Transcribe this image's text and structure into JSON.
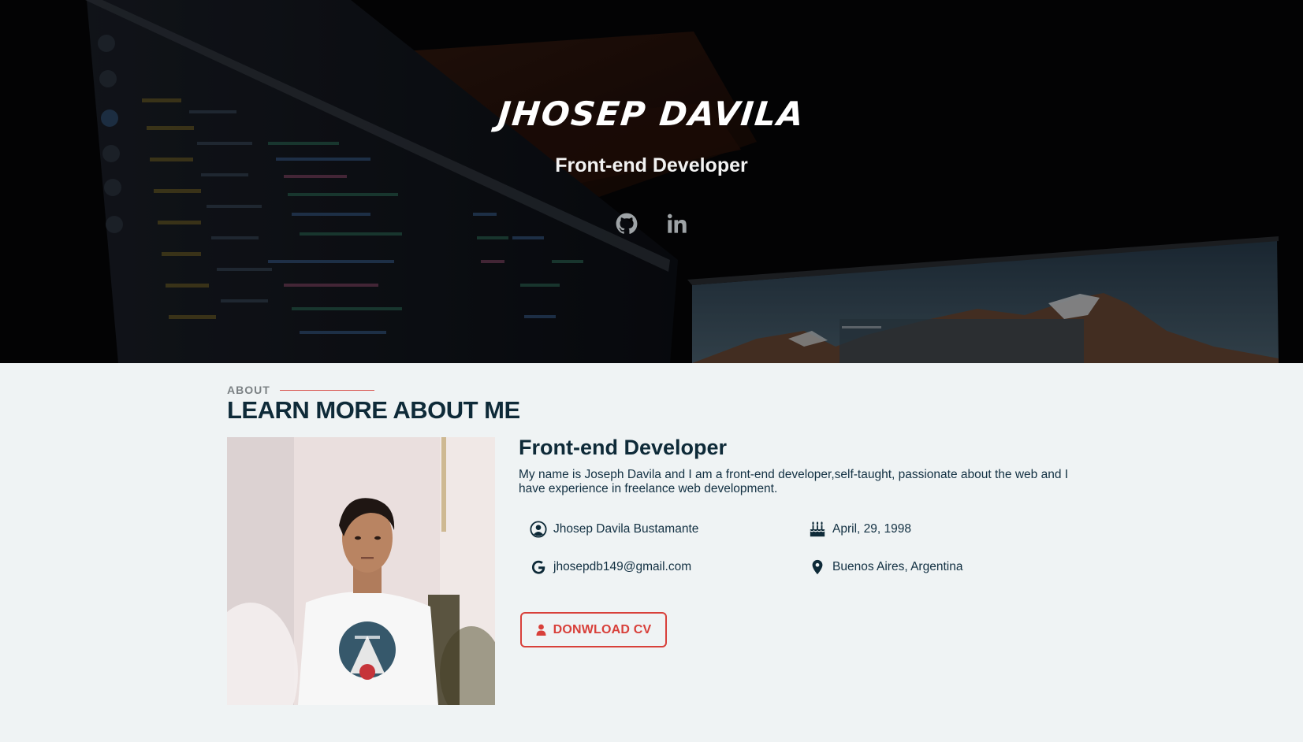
{
  "hero": {
    "name": "JHOSEP DAVILA",
    "role": "Front-end Developer",
    "social": [
      {
        "icon": "github-icon"
      },
      {
        "icon": "linkedin-icon"
      }
    ]
  },
  "about": {
    "eyebrow": "ABOUT",
    "title": "LEARN MORE ABOUT ME",
    "subtitle": "Front-end Developer",
    "description": "My name is Joseph Davila and I am a front-end developer,self-taught, passionate about the web and I have experience in freelance web development.",
    "details": {
      "full_name": "Jhosep Davila Bustamante",
      "birthday": "April, 29, 1998",
      "email": "jhosepdb149@gmail.com",
      "location": "Buenos Aires, Argentina"
    },
    "cv_button": "DONWLOAD CV"
  },
  "colors": {
    "accent": "#d8403a",
    "heading": "#0e2a38",
    "page_bg": "#eff3f4",
    "hero_bg": "#050507"
  }
}
